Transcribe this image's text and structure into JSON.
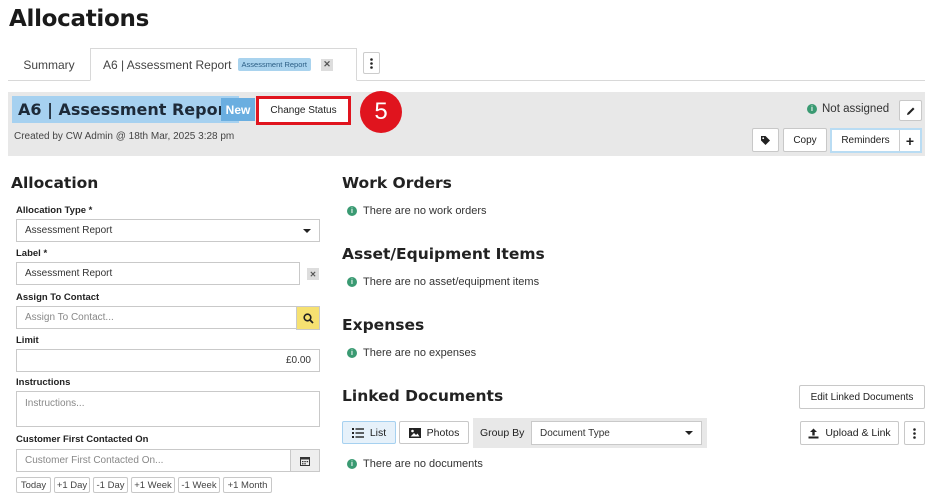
{
  "page": {
    "title": "Allocations"
  },
  "tabs": {
    "summary_label": "Summary",
    "active_label": "A6 | Assessment Report",
    "active_badge": "Assessment Report"
  },
  "record": {
    "title": "A6 | Assessment Report",
    "status_badge": "New",
    "change_status_label": "Change Status",
    "step_number": "5",
    "created_text": "Created by CW Admin @ 18th Mar, 2025 3:28 pm",
    "assignee_text": "Not assigned",
    "copy_label": "Copy",
    "reminders_label": "Reminders",
    "plus_label": "+"
  },
  "allocation": {
    "heading": "Allocation",
    "type_label": "Allocation Type *",
    "type_value": "Assessment Report",
    "label_label": "Label *",
    "label_value": "Assessment Report",
    "contact_label": "Assign To Contact",
    "contact_placeholder": "Assign To Contact...",
    "limit_label": "Limit",
    "limit_value": "£0.00",
    "instructions_label": "Instructions",
    "instructions_placeholder": "Instructions...",
    "contacted_label": "Customer First Contacted On",
    "contacted_placeholder": "Customer First Contacted On...",
    "date_buttons": [
      "Today",
      "+1 Day",
      "-1 Day",
      "+1 Week",
      "-1 Week",
      "+1 Month"
    ]
  },
  "work_orders": {
    "heading": "Work Orders",
    "empty": "There are no work orders"
  },
  "assets": {
    "heading": "Asset/Equipment Items",
    "empty": "There are no asset/equipment items"
  },
  "expenses": {
    "heading": "Expenses",
    "empty": "There are no expenses"
  },
  "linked_docs": {
    "heading": "Linked Documents",
    "edit_label": "Edit Linked Documents",
    "list_label": "List",
    "photos_label": "Photos",
    "group_by_label": "Group By",
    "group_by_value": "Document Type",
    "upload_label": "Upload & Link",
    "empty": "There are no documents"
  },
  "colors": {
    "accent_blue": "#a6d1f0",
    "status_blue": "#6aaee0",
    "highlight_red": "#e0141e",
    "info_green": "#3a9a72",
    "search_yellow": "#f6e171"
  }
}
